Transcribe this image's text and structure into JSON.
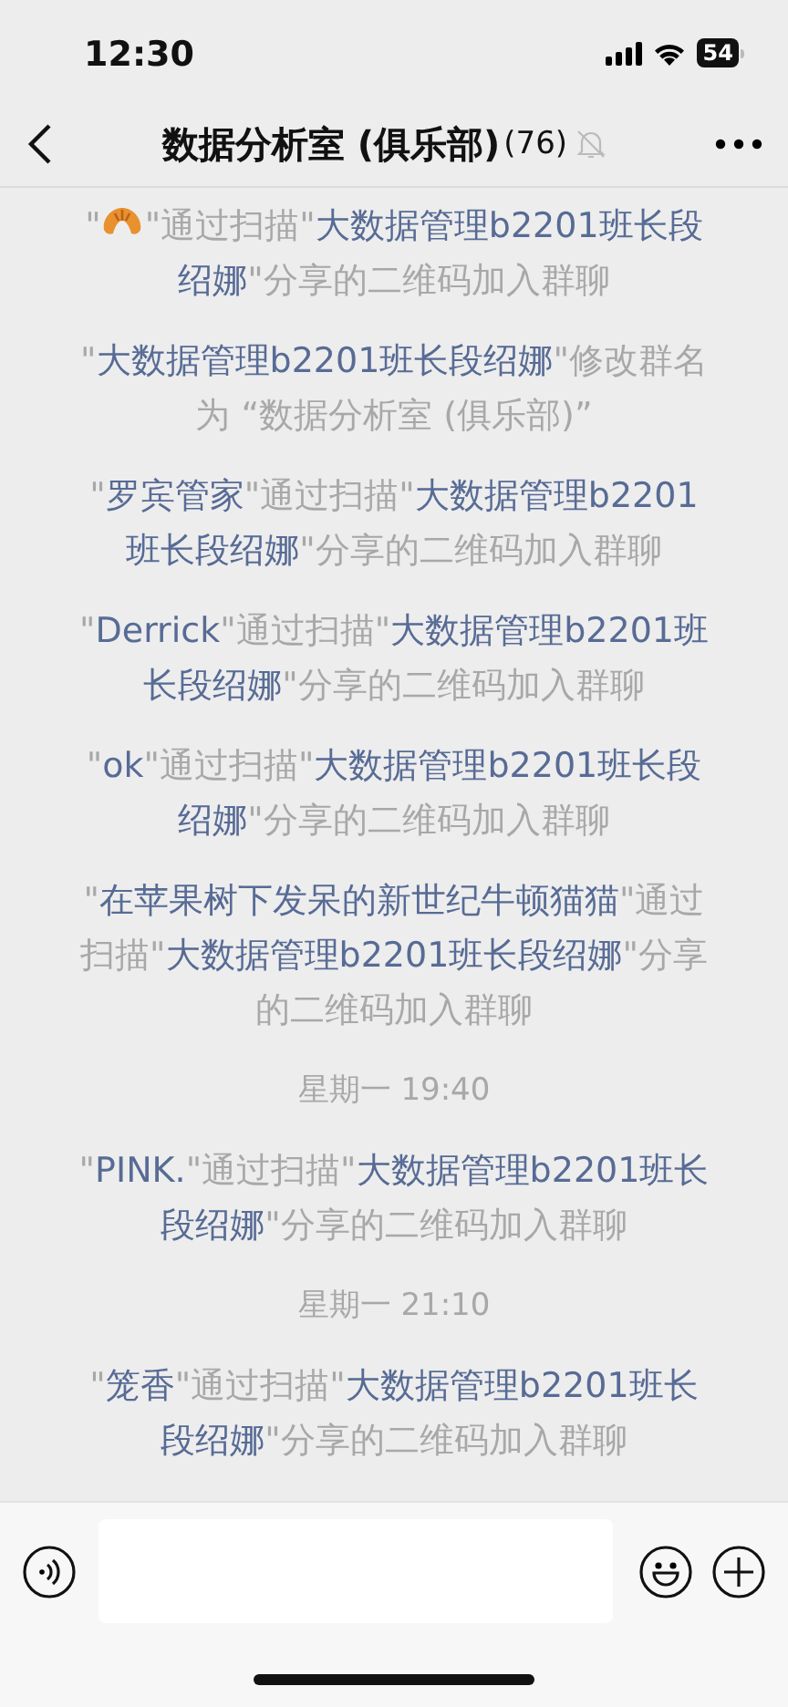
{
  "status_bar": {
    "time": "12:30",
    "battery": "54"
  },
  "header": {
    "title": "数据分析室 (俱乐部)",
    "count": "(76)",
    "muted": true
  },
  "messages": [
    {
      "kind": "system",
      "parts": [
        {
          "kind": "text",
          "text": "\""
        },
        {
          "kind": "icon"
        },
        {
          "kind": "text",
          "text": "\"通过扫描\""
        },
        {
          "kind": "name",
          "text": "大数据管理b2201班长段绍娜"
        },
        {
          "kind": "text",
          "text": "\"分享的二维码加入群聊"
        }
      ]
    },
    {
      "kind": "system",
      "parts": [
        {
          "kind": "text",
          "text": "\""
        },
        {
          "kind": "name",
          "text": "大数据管理b2201班长段绍娜"
        },
        {
          "kind": "text",
          "text": "\"修改群名为 “数据分析室 (俱乐部)”"
        }
      ]
    },
    {
      "kind": "system",
      "parts": [
        {
          "kind": "text",
          "text": "\""
        },
        {
          "kind": "name",
          "text": "罗宾管家"
        },
        {
          "kind": "text",
          "text": "\"通过扫描\""
        },
        {
          "kind": "name",
          "text": "大数据管理b2201班长段绍娜"
        },
        {
          "kind": "text",
          "text": "\"分享的二维码加入群聊"
        }
      ]
    },
    {
      "kind": "system",
      "parts": [
        {
          "kind": "text",
          "text": "\""
        },
        {
          "kind": "name",
          "text": "Derrick"
        },
        {
          "kind": "text",
          "text": "\"通过扫描\""
        },
        {
          "kind": "name",
          "text": "大数据管理b2201班长段绍娜"
        },
        {
          "kind": "text",
          "text": "\"分享的二维码加入群聊"
        }
      ]
    },
    {
      "kind": "system",
      "parts": [
        {
          "kind": "text",
          "text": "\""
        },
        {
          "kind": "name",
          "text": "ok"
        },
        {
          "kind": "text",
          "text": "\"通过扫描\""
        },
        {
          "kind": "name",
          "text": "大数据管理b2201班长段绍娜"
        },
        {
          "kind": "text",
          "text": "\"分享的二维码加入群聊"
        }
      ]
    },
    {
      "kind": "system",
      "parts": [
        {
          "kind": "text",
          "text": "\""
        },
        {
          "kind": "name",
          "text": "在苹果树下发呆的新世纪牛顿猫猫"
        },
        {
          "kind": "text",
          "text": "\"通过扫描\""
        },
        {
          "kind": "name",
          "text": "大数据管理b2201班长段绍娜"
        },
        {
          "kind": "text",
          "text": "\"分享的二维码加入群聊"
        }
      ]
    },
    {
      "kind": "time",
      "text": "星期一 19:40"
    },
    {
      "kind": "system",
      "parts": [
        {
          "kind": "text",
          "text": "\""
        },
        {
          "kind": "name",
          "text": "PINK."
        },
        {
          "kind": "text",
          "text": "\"通过扫描\""
        },
        {
          "kind": "name",
          "text": "大数据管理b2201班长段绍娜"
        },
        {
          "kind": "text",
          "text": "\"分享的二维码加入群聊"
        }
      ]
    },
    {
      "kind": "time",
      "text": "星期一 21:10"
    },
    {
      "kind": "system",
      "parts": [
        {
          "kind": "text",
          "text": "\""
        },
        {
          "kind": "name",
          "text": "笼香"
        },
        {
          "kind": "text",
          "text": "\"通过扫描\""
        },
        {
          "kind": "name",
          "text": "大数据管理b2201班长段绍娜"
        },
        {
          "kind": "text",
          "text": "\"分享的二维码加入群聊"
        }
      ]
    }
  ]
}
